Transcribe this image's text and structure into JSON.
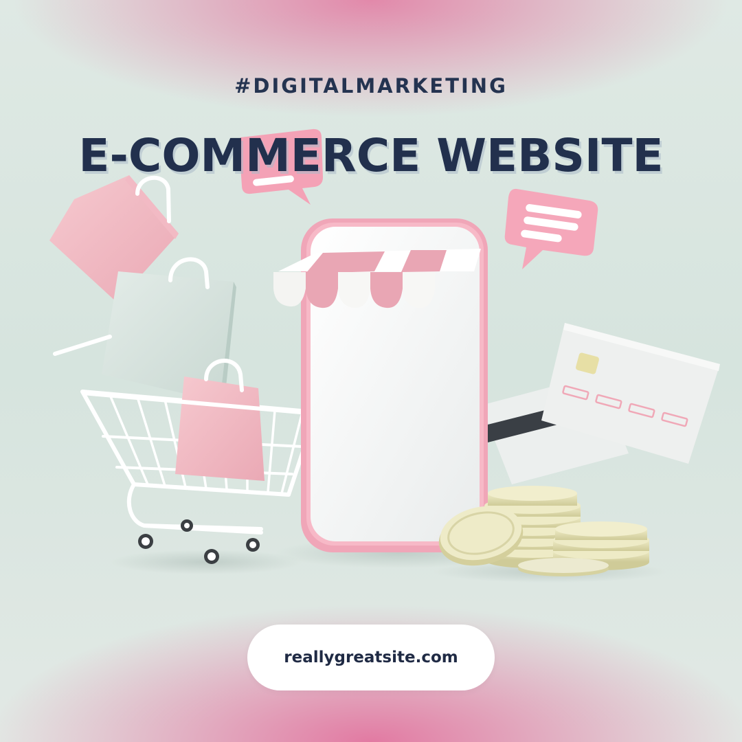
{
  "header": {
    "hashtag": "#DIGITALMARKETING",
    "title": "E-COMMERCE WEBSITE"
  },
  "footer": {
    "url": "reallygreatsite.com"
  },
  "illustration": {
    "icons": [
      "shopping-bag-icon",
      "shopping-cart-icon",
      "storefront-phone-icon",
      "chat-bubble-icon",
      "credit-card-icon",
      "coin-stack-icon"
    ]
  },
  "colors": {
    "background": "#d8e5df",
    "accent_pink": "#f1a7b8",
    "text_navy": "#22304d",
    "coin": "#e6e2b7"
  }
}
